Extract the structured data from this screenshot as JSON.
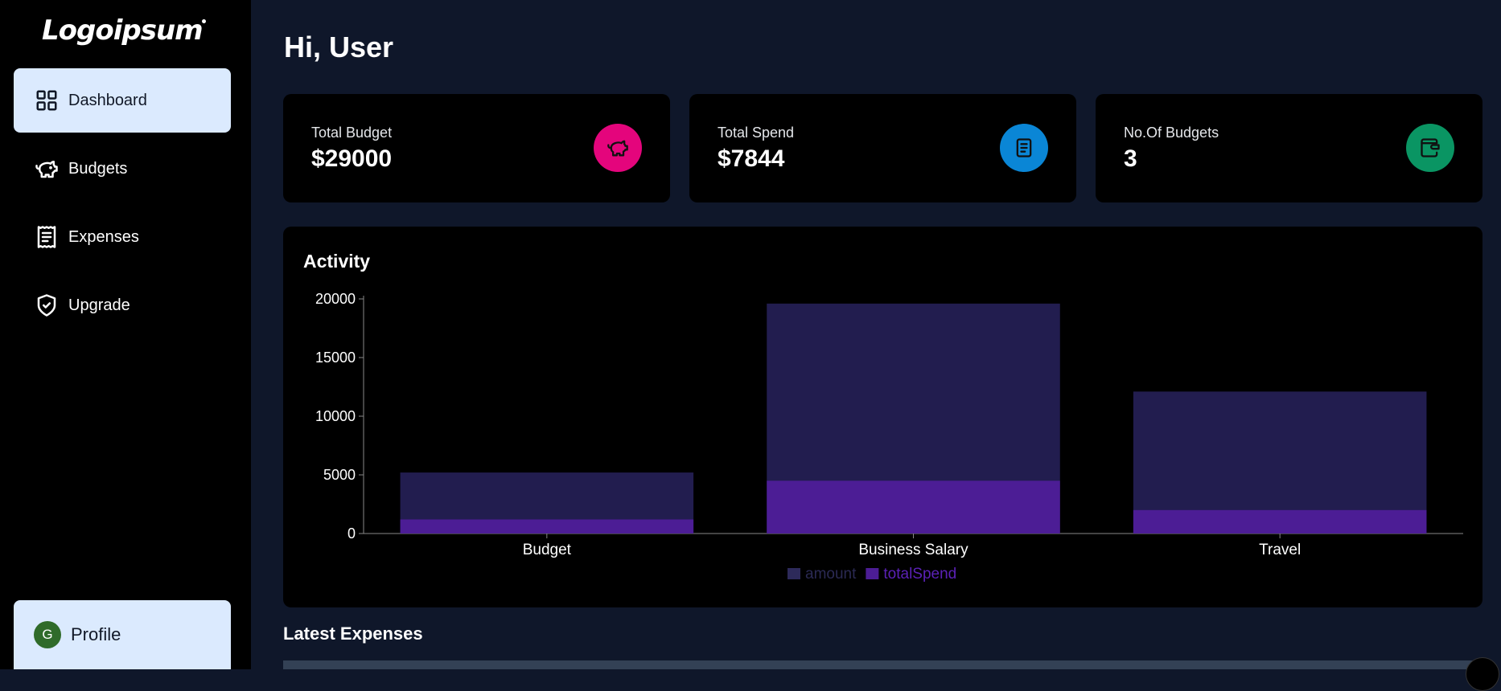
{
  "sidebar": {
    "logo": "Logoipsum",
    "items": [
      {
        "label": "Dashboard",
        "icon": "dashboard-grid-icon",
        "active": true
      },
      {
        "label": "Budgets",
        "icon": "piggy-bank-icon",
        "active": false
      },
      {
        "label": "Expenses",
        "icon": "receipt-icon",
        "active": false
      },
      {
        "label": "Upgrade",
        "icon": "shield-check-icon",
        "active": false
      }
    ],
    "profile": {
      "label": "Profile",
      "avatar_letter": "G",
      "avatar_color": "#2f6b2a"
    }
  },
  "main": {
    "greeting": "Hi, User",
    "cards": [
      {
        "label": "Total Budget",
        "value": "$29000",
        "icon": "piggy-bank-icon",
        "color": "#e4057c"
      },
      {
        "label": "Total Spend",
        "value": "$7844",
        "icon": "receipt-icon",
        "color": "#0a86d6"
      },
      {
        "label": "No.Of Budgets",
        "value": "3",
        "icon": "wallet-icon",
        "color": "#0a9563"
      }
    ],
    "activity_title": "Activity",
    "latest_title": "Latest Expenses"
  },
  "chart_data": {
    "type": "bar",
    "categories": [
      "Budget",
      "Business Salary",
      "Travel"
    ],
    "series": [
      {
        "name": "amount",
        "values": [
          5200,
          19600,
          12100
        ],
        "color": "#221d4f"
      },
      {
        "name": "totalSpend",
        "values": [
          1200,
          4500,
          2000
        ],
        "color": "#4c1d95"
      }
    ],
    "stacked": false,
    "overlapping": true,
    "yticks": [
      0,
      5000,
      10000,
      15000,
      20000
    ],
    "ylim": [
      0,
      20000
    ],
    "legend": "bottom-center",
    "grid": false
  }
}
